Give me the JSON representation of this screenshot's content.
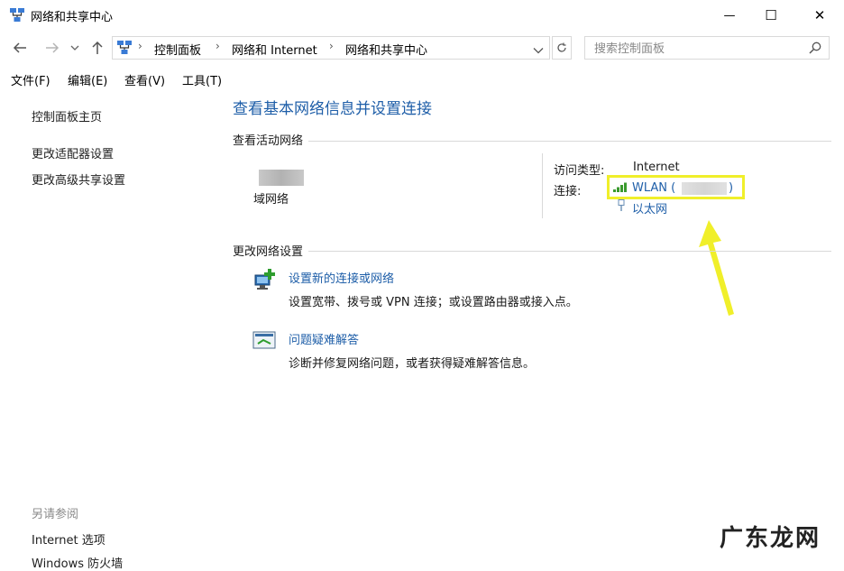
{
  "window": {
    "title": "网络和共享中心",
    "controls": {
      "minimize": "—",
      "maximize": "☐",
      "close": "✕"
    }
  },
  "address_bar": {
    "breadcrumbs": [
      "控制面板",
      "网络和 Internet",
      "网络和共享中心"
    ],
    "search_placeholder": "搜索控制面板"
  },
  "menu": {
    "items": [
      "文件(F)",
      "编辑(E)",
      "查看(V)",
      "工具(T)"
    ]
  },
  "left_pane": {
    "links": [
      "控制面板主页",
      "更改适配器设置",
      "更改高级共享设置"
    ],
    "see_also_title": "另请参阅",
    "see_also": [
      "Internet 选项",
      "Windows 防火墙"
    ]
  },
  "main": {
    "title": "查看基本网络信息并设置连接",
    "active_networks": {
      "heading": "查看活动网络",
      "network_type": "域网络",
      "access_type_label": "访问类型:",
      "access_type_value": "Internet",
      "connection_label": "连接:",
      "wlan_prefix": "WLAN (",
      "wlan_suffix": ")",
      "ethernet": "以太网"
    },
    "change_settings": {
      "heading": "更改网络设置",
      "items": [
        {
          "title": "设置新的连接或网络",
          "description": "设置宽带、拨号或 VPN 连接；或设置路由器或接入点。",
          "icon": "network-setup-icon"
        },
        {
          "title": "问题疑难解答",
          "description": "诊断并修复网络问题，或者获得疑难解答信息。",
          "icon": "troubleshoot-icon"
        }
      ]
    }
  },
  "annotation": {
    "highlight_color": "#f0ef2a",
    "arrow_color": "#f0ef2a"
  },
  "watermark": "广东龙网",
  "colors": {
    "link": "#1e5ea8",
    "border": "#d9d9d9"
  }
}
